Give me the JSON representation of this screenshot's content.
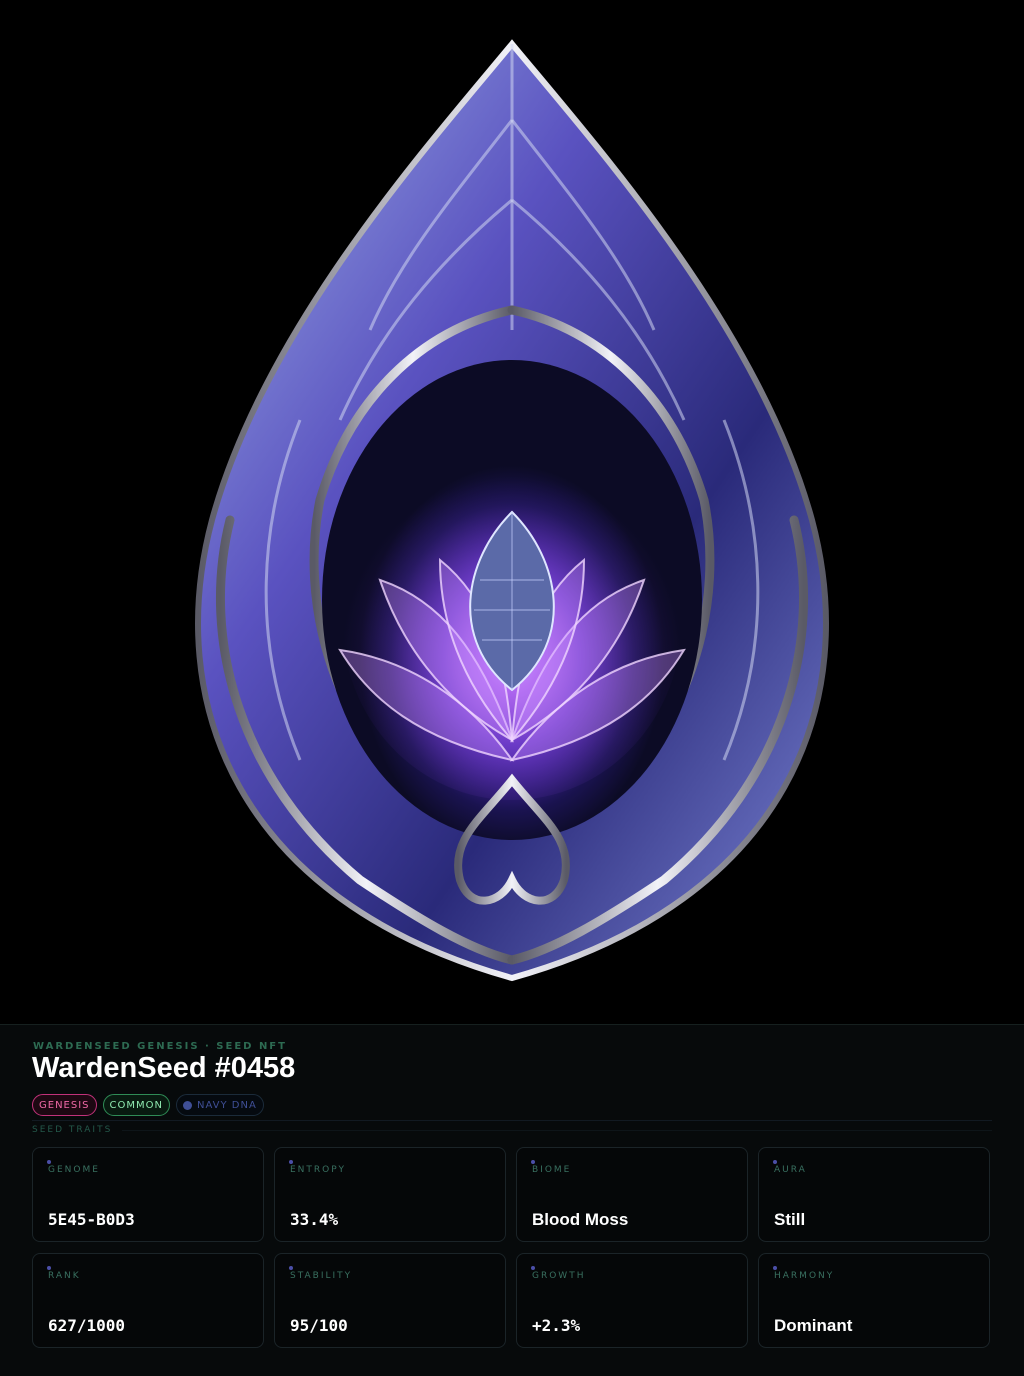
{
  "hero": {
    "image": "crystal-seed-artwork",
    "accent": "#8a4dff"
  },
  "header": {
    "kicker": "WARDENSEED GENESIS · SEED NFT",
    "title": "WardenSeed #0458"
  },
  "tags": [
    {
      "label": "GENESIS",
      "color": "#f06aa7"
    },
    {
      "label": "COMMON",
      "color": "#8fe8b0"
    },
    {
      "label": "NAVY DNA",
      "color": "#3f4f96"
    }
  ],
  "section_label": "SEED TRAITS",
  "traits": [
    {
      "label": "GENOME",
      "value": "5E45-B0D3"
    },
    {
      "label": "ENTROPY",
      "value": "33.4%"
    },
    {
      "label": "BIOME",
      "value": "Blood Moss"
    },
    {
      "label": "AURA",
      "value": "Still"
    },
    {
      "label": "RANK",
      "value": "627/1000"
    },
    {
      "label": "STABILITY",
      "value": "95/100"
    },
    {
      "label": "GROWTH",
      "value": "+2.3%"
    },
    {
      "label": "HARMONY",
      "value": "Dominant"
    }
  ]
}
